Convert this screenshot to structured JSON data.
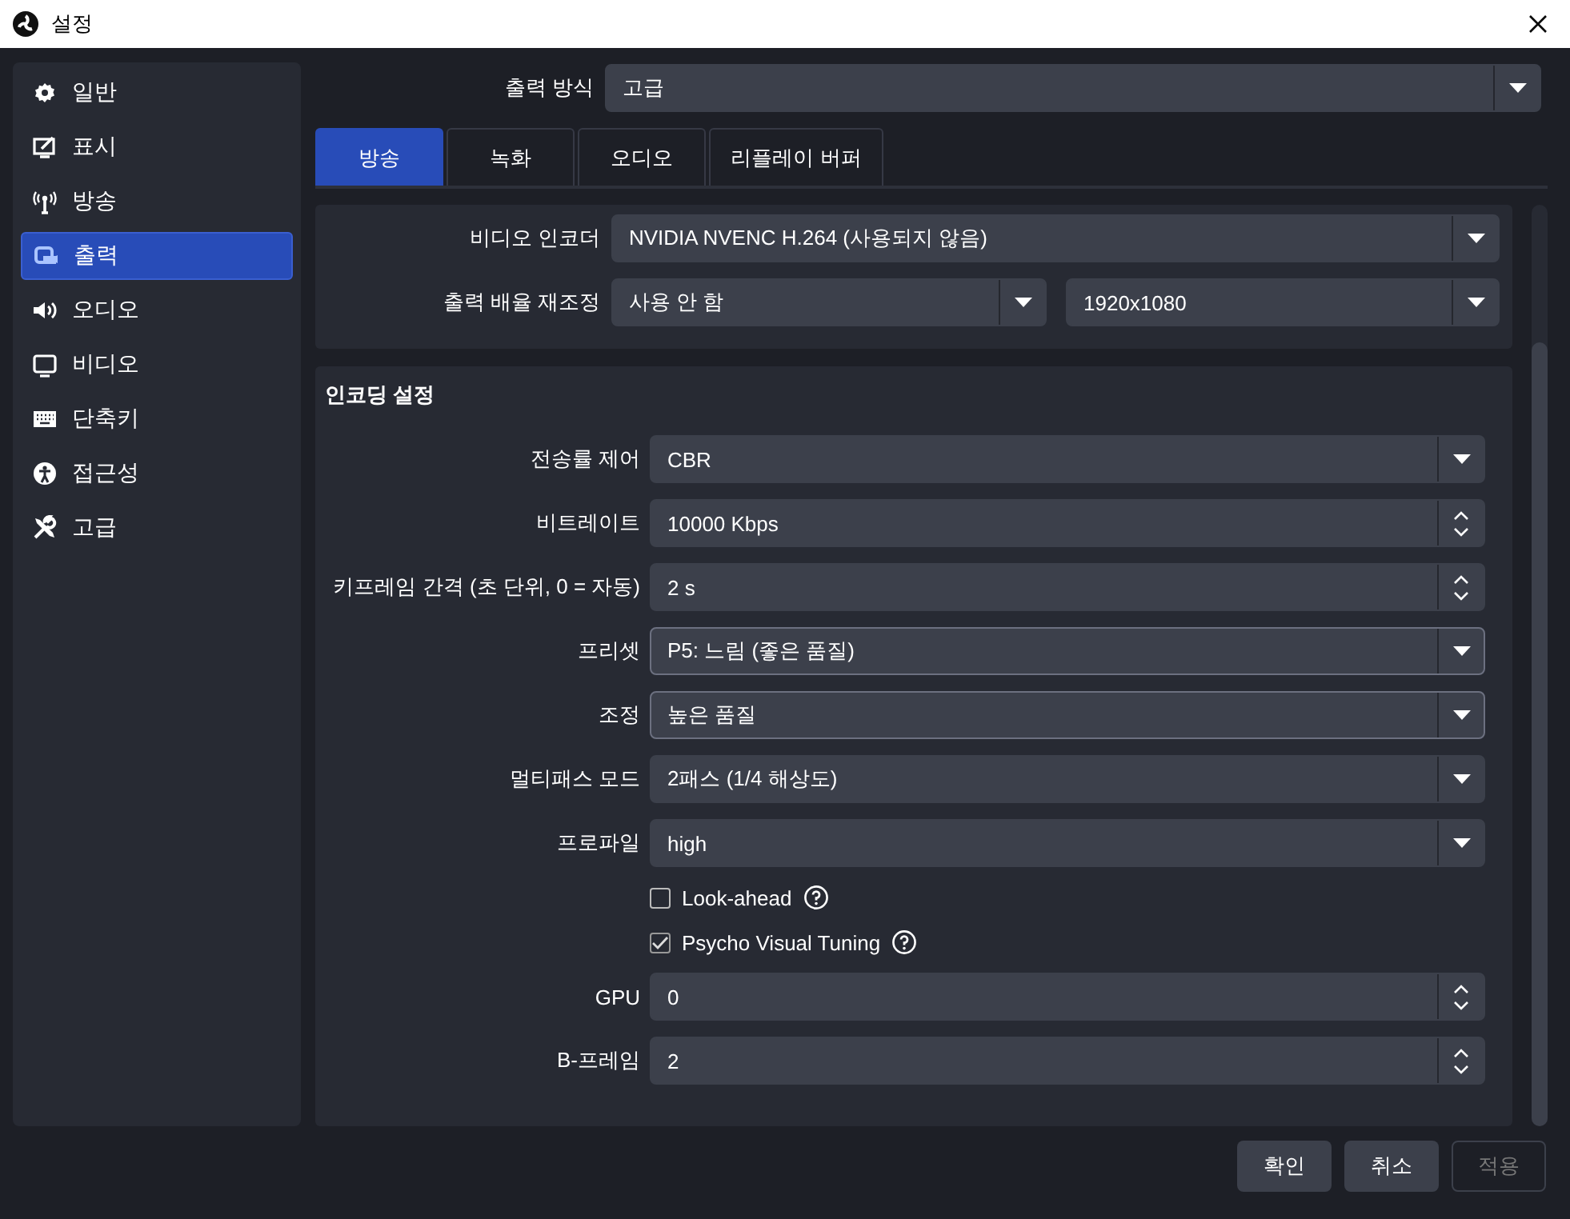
{
  "window": {
    "title": "설정"
  },
  "sidebar": {
    "items": [
      {
        "label": "일반",
        "selected": false
      },
      {
        "label": "표시",
        "selected": false
      },
      {
        "label": "방송",
        "selected": false
      },
      {
        "label": "출력",
        "selected": true
      },
      {
        "label": "오디오",
        "selected": false
      },
      {
        "label": "비디오",
        "selected": false
      },
      {
        "label": "단축키",
        "selected": false
      },
      {
        "label": "접근성",
        "selected": false
      },
      {
        "label": "고급",
        "selected": false
      }
    ]
  },
  "output_mode": {
    "label": "출력 방식",
    "value": "고급"
  },
  "tabs": [
    {
      "label": "방송",
      "selected": true
    },
    {
      "label": "녹화",
      "selected": false
    },
    {
      "label": "오디오",
      "selected": false
    },
    {
      "label": "리플레이 버퍼",
      "selected": false
    }
  ],
  "encoder_panel": {
    "rows": [
      {
        "label": "비디오 인코더",
        "controls": [
          {
            "kind": "combo",
            "value": "NVIDIA NVENC H.264 (사용되지 않음)"
          }
        ]
      },
      {
        "label": "출력 배율 재조정",
        "controls": [
          {
            "kind": "combo",
            "value": "사용 안 함"
          },
          {
            "kind": "combo",
            "value": "1920x1080"
          }
        ]
      }
    ]
  },
  "encoding_settings": {
    "title": "인코딩 설정",
    "rows": [
      {
        "kind": "combo",
        "label": "전송률 제어",
        "value": "CBR",
        "focused": false
      },
      {
        "kind": "spin",
        "label": "비트레이트",
        "value": "10000 Kbps"
      },
      {
        "kind": "spin",
        "label": "키프레임 간격 (초 단위, 0 = 자동)",
        "value": "2 s"
      },
      {
        "kind": "combo",
        "label": "프리셋",
        "value": "P5: 느림 (좋은 품질)",
        "focused": true
      },
      {
        "kind": "combo",
        "label": "조정",
        "value": "높은 품질",
        "focused": true
      },
      {
        "kind": "combo",
        "label": "멀티패스 모드",
        "value": "2패스 (1/4 해상도)",
        "focused": false
      },
      {
        "kind": "combo",
        "label": "프로파일",
        "value": "high",
        "focused": false
      },
      {
        "kind": "checkbox",
        "label": "Look-ahead",
        "checked": false
      },
      {
        "kind": "checkbox",
        "label": "Psycho Visual Tuning",
        "checked": true
      },
      {
        "kind": "spin",
        "label": "GPU",
        "value": "0"
      },
      {
        "kind": "spin",
        "label": "B-프레임",
        "value": "2"
      }
    ]
  },
  "buttons": [
    {
      "label": "확인",
      "disabled": false
    },
    {
      "label": "취소",
      "disabled": false
    },
    {
      "label": "적용",
      "disabled": true
    }
  ]
}
